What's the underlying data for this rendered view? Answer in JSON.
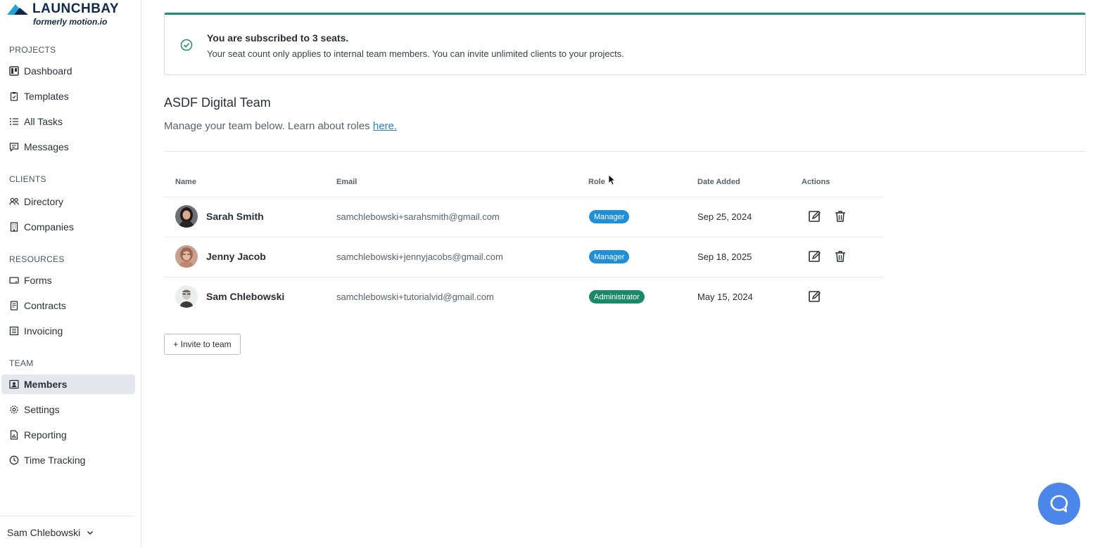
{
  "brand": {
    "name": "LAUNCHBAY",
    "tagline": "formerly motion.io",
    "color": "#12294a",
    "accent": "#1fa2d8"
  },
  "sidebar": {
    "sections": [
      {
        "label": "PROJECTS",
        "items": [
          {
            "label": "Dashboard",
            "icon": "dashboard-icon"
          },
          {
            "label": "Templates",
            "icon": "clipboard-icon"
          },
          {
            "label": "All Tasks",
            "icon": "list-icon"
          },
          {
            "label": "Messages",
            "icon": "message-icon"
          }
        ]
      },
      {
        "label": "CLIENTS",
        "items": [
          {
            "label": "Directory",
            "icon": "people-icon"
          },
          {
            "label": "Companies",
            "icon": "building-icon"
          }
        ]
      },
      {
        "label": "RESOURCES",
        "items": [
          {
            "label": "Forms",
            "icon": "form-icon"
          },
          {
            "label": "Contracts",
            "icon": "document-icon"
          },
          {
            "label": "Invoicing",
            "icon": "invoice-icon"
          }
        ]
      },
      {
        "label": "TEAM",
        "items": [
          {
            "label": "Members",
            "icon": "member-icon",
            "active": true
          },
          {
            "label": "Settings",
            "icon": "gear-icon"
          },
          {
            "label": "Reporting",
            "icon": "report-icon"
          },
          {
            "label": "Time Tracking",
            "icon": "clock-icon"
          }
        ]
      }
    ],
    "user": "Sam Chlebowski"
  },
  "notice": {
    "title": "You are subscribed to 3 seats.",
    "body": "Your seat count only applies to internal team members. You can invite unlimited clients to your projects.",
    "color": "#1f8f6a"
  },
  "team": {
    "title": "ASDF Digital Team",
    "subtitle": "Manage your team below. Learn about roles ",
    "link": "here."
  },
  "table": {
    "headers": {
      "name": "Name",
      "email": "Email",
      "role": "Role",
      "date": "Date Added",
      "actions": "Actions"
    },
    "rows": [
      {
        "name": "Sarah Smith",
        "email": "samchlebowski+sarahsmith@gmail.com",
        "role": "Manager",
        "role_color": "#1f8fd8",
        "date": "Sep 25, 2024",
        "deletable": true
      },
      {
        "name": "Jenny Jacob",
        "email": "samchlebowski+jennyjacobs@gmail.com",
        "role": "Manager",
        "role_color": "#1f8fd8",
        "date": "Sep 18, 2025",
        "deletable": true
      },
      {
        "name": "Sam Chlebowski",
        "email": "samchlebowski+tutorialvid@gmail.com",
        "role": "Administrator",
        "role_color": "#1a8a66",
        "date": "May 15, 2024",
        "deletable": false
      }
    ]
  },
  "invite_label": "+ Invite to team",
  "help_color": "#4c86e8"
}
